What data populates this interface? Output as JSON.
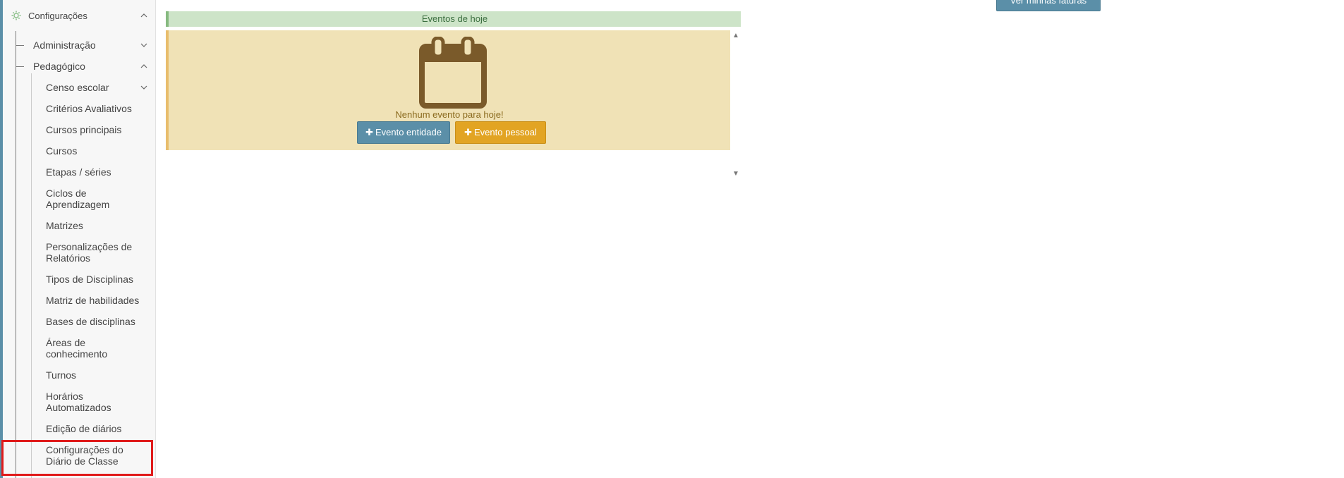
{
  "sidebar": {
    "root": {
      "label": "Configurações",
      "icon": "gear-icon"
    },
    "groups": [
      {
        "label": "Administração",
        "expanded": false
      },
      {
        "label": "Pedagógico",
        "expanded": true
      }
    ],
    "items": [
      "Censo escolar",
      "Critérios Avaliativos",
      "Cursos principais",
      "Cursos",
      "Etapas / séries",
      "Ciclos de Aprendizagem",
      "Matrizes",
      "Personalizações de Relatórios",
      "Tipos de Disciplinas",
      "Matriz de habilidades",
      "Bases de disciplinas",
      "Áreas de conhecimento",
      "Turnos",
      "Horários Automatizados",
      "Edição de diários",
      "Configurações do Diário de Classe"
    ]
  },
  "events": {
    "header": "Eventos de hoje",
    "empty_message": "Nenhum evento para hoje!",
    "btn_entidade": "Evento entidade",
    "btn_pessoal": "Evento pessoal",
    "icon": "calendar-icon"
  },
  "top_button": {
    "label": "Ver minhas faturas"
  },
  "colors": {
    "accent_blue": "#5b8fa8",
    "accent_orange": "#e2a423",
    "events_bg": "#f0e2b6",
    "header_green": "#cde4c8",
    "highlight_red": "#e01b1b"
  }
}
